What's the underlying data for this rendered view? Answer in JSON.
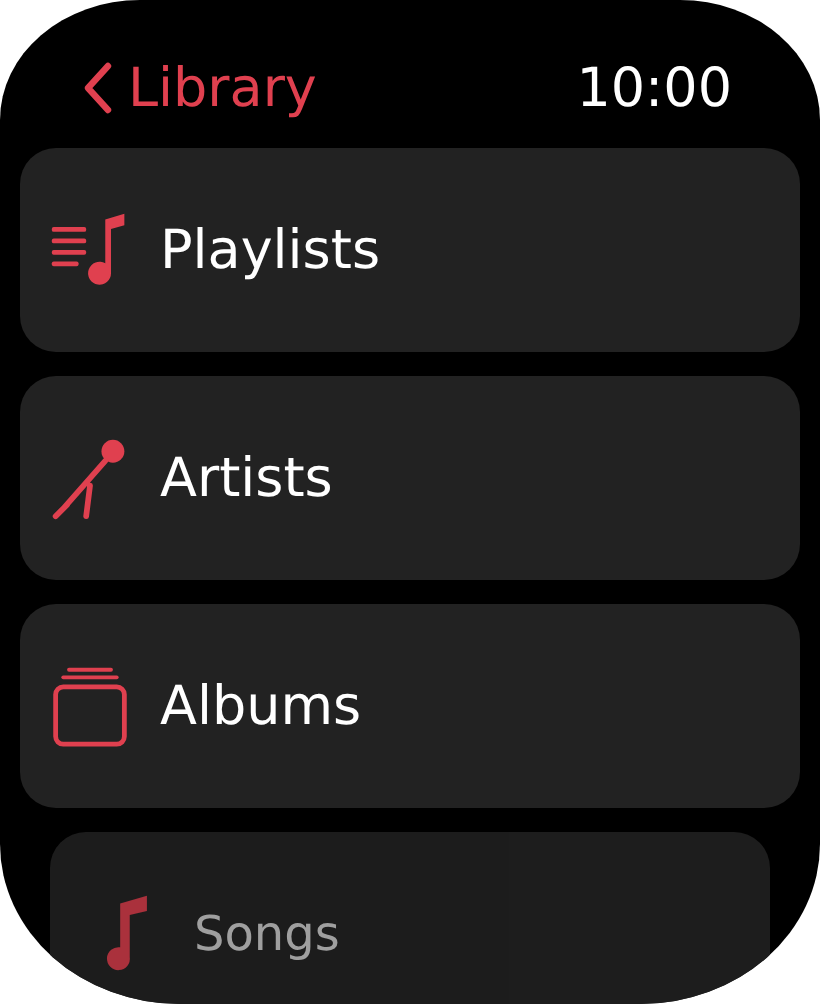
{
  "header": {
    "back_label": "Library",
    "time": "10:00"
  },
  "items": [
    {
      "label": "Playlists",
      "kind": "playlists",
      "receding": false
    },
    {
      "label": "Artists",
      "kind": "artists",
      "receding": false
    },
    {
      "label": "Albums",
      "kind": "albums",
      "receding": false
    },
    {
      "label": "Songs",
      "kind": "songs",
      "receding": true
    }
  ]
}
